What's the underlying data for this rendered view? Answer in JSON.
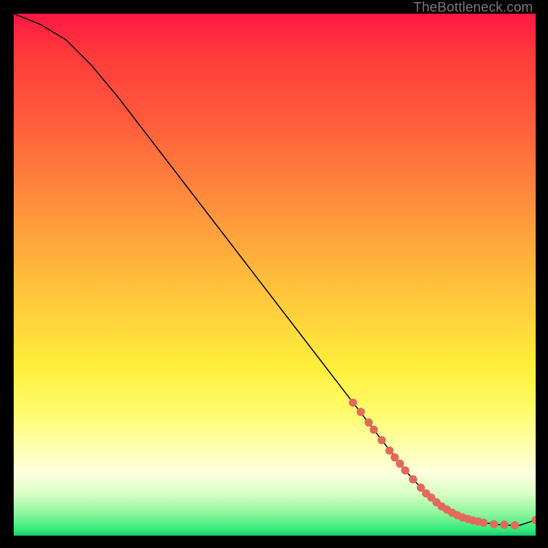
{
  "watermark": "TheBottleneck.com",
  "chart_data": {
    "type": "line",
    "title": "",
    "xlabel": "",
    "ylabel": "",
    "xlim": [
      0,
      100
    ],
    "ylim": [
      0,
      100
    ],
    "grid": false,
    "series": [
      {
        "name": "curve",
        "color": "#000000",
        "x": [
          0,
          5,
          10,
          15,
          20,
          25,
          30,
          35,
          40,
          45,
          50,
          55,
          60,
          65,
          70,
          75,
          80,
          83,
          86,
          90,
          94,
          97,
          100
        ],
        "values": [
          100,
          98,
          95,
          90,
          84,
          77.5,
          71,
          64.5,
          58,
          51.5,
          45,
          38.5,
          32,
          25.5,
          19,
          12.5,
          7,
          5,
          3.5,
          2.5,
          2,
          2,
          3
        ]
      }
    ],
    "markers": [
      {
        "x": 65.0,
        "y": 25.5
      },
      {
        "x": 66.5,
        "y": 23.7
      },
      {
        "x": 68.0,
        "y": 21.7
      },
      {
        "x": 69.0,
        "y": 20.3
      },
      {
        "x": 70.5,
        "y": 18.3
      },
      {
        "x": 72.0,
        "y": 16.3
      },
      {
        "x": 73.0,
        "y": 15.0
      },
      {
        "x": 74.0,
        "y": 13.8
      },
      {
        "x": 75.0,
        "y": 12.5
      },
      {
        "x": 76.5,
        "y": 10.8
      },
      {
        "x": 78.0,
        "y": 9.2
      },
      {
        "x": 79.0,
        "y": 8.1
      },
      {
        "x": 80.0,
        "y": 7.3
      },
      {
        "x": 81.0,
        "y": 6.4
      },
      {
        "x": 82.0,
        "y": 5.6
      },
      {
        "x": 83.0,
        "y": 5.0
      },
      {
        "x": 84.0,
        "y": 4.4
      },
      {
        "x": 85.0,
        "y": 3.9
      },
      {
        "x": 86.0,
        "y": 3.5
      },
      {
        "x": 87.0,
        "y": 3.2
      },
      {
        "x": 88.0,
        "y": 2.9
      },
      {
        "x": 89.0,
        "y": 2.7
      },
      {
        "x": 90.0,
        "y": 2.5
      },
      {
        "x": 92.0,
        "y": 2.2
      },
      {
        "x": 94.0,
        "y": 2.1
      },
      {
        "x": 96.0,
        "y": 2.0
      },
      {
        "x": 100.0,
        "y": 3.0
      }
    ],
    "marker_style": {
      "color": "#e26a5a",
      "radius_px": 6
    }
  }
}
